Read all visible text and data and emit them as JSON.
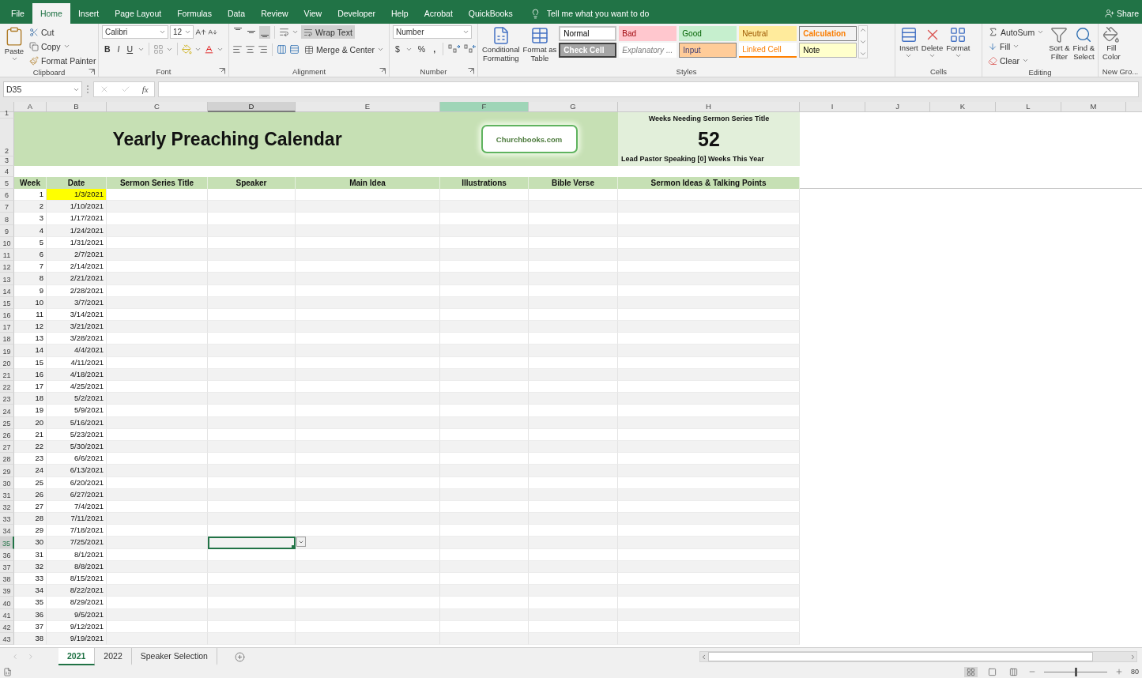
{
  "menu_tabs": [
    {
      "label": "File",
      "selected": false
    },
    {
      "label": "Home",
      "selected": true
    },
    {
      "label": "Insert",
      "selected": false
    },
    {
      "label": "Page Layout",
      "selected": false
    },
    {
      "label": "Formulas",
      "selected": false
    },
    {
      "label": "Data",
      "selected": false
    },
    {
      "label": "Review",
      "selected": false
    },
    {
      "label": "View",
      "selected": false
    },
    {
      "label": "Developer",
      "selected": false
    },
    {
      "label": "Help",
      "selected": false
    },
    {
      "label": "Acrobat",
      "selected": false
    },
    {
      "label": "QuickBooks",
      "selected": false
    }
  ],
  "tell_me": "Tell me what you want to do",
  "share": "Share",
  "ribbon": {
    "clipboard": {
      "paste": "Paste",
      "cut": "Cut",
      "copy": "Copy",
      "format_painter": "Format Painter",
      "label": "Clipboard"
    },
    "font": {
      "name": "Calibri",
      "size": "12",
      "bold": "B",
      "italic": "I",
      "underline": "U",
      "label": "Font"
    },
    "alignment": {
      "vertical_align": [
        {
          "selected": false
        },
        {
          "selected": false
        },
        {
          "selected": true
        }
      ],
      "wrap_text": {
        "label": "Wrap Text",
        "selected": true
      },
      "merge": "Merge & Center",
      "label": "Alignment"
    },
    "number": {
      "format": "Number",
      "currency": "$",
      "percent": "%",
      "comma": ",",
      "label": "Number"
    },
    "styles": {
      "conditional": [
        "Conditional",
        "Formatting"
      ],
      "format_table": [
        "Format as",
        "Table"
      ],
      "gallery": [
        {
          "kind": "normal",
          "label": "Normal"
        },
        {
          "kind": "bad",
          "label": "Bad"
        },
        {
          "kind": "good",
          "label": "Good"
        },
        {
          "kind": "neutral",
          "label": "Neutral"
        },
        {
          "kind": "calculation",
          "label": "Calculation"
        },
        {
          "kind": "check",
          "label": "Check Cell"
        },
        {
          "kind": "explanatory",
          "label": "Explanatory ..."
        },
        {
          "kind": "input",
          "label": "Input"
        },
        {
          "kind": "linked",
          "label": "Linked Cell"
        },
        {
          "kind": "note",
          "label": "Note"
        }
      ],
      "label": "Styles"
    },
    "cells": {
      "buttons": [
        "Insert",
        "Delete",
        "Format"
      ],
      "label": "Cells"
    },
    "editing": {
      "autosum": "AutoSum",
      "fill": "Fill",
      "clear": "Clear",
      "sort": [
        "Sort &",
        "Filter"
      ],
      "find": [
        "Find &",
        "Select"
      ],
      "label": "Editing"
    },
    "new_group": {
      "fill_color": [
        "Fill",
        "Color"
      ],
      "label": "New Gro..."
    }
  },
  "formula_bar": {
    "name_box": "D35",
    "fx": "fx"
  },
  "column_headers": [
    {
      "label": "A",
      "selected": false,
      "highlighted": false
    },
    {
      "label": "B",
      "selected": false,
      "highlighted": false
    },
    {
      "label": "C",
      "selected": false,
      "highlighted": false
    },
    {
      "label": "D",
      "selected": true,
      "highlighted": false
    },
    {
      "label": "E",
      "selected": false,
      "highlighted": false
    },
    {
      "label": "F",
      "selected": false,
      "highlighted": true
    },
    {
      "label": "G",
      "selected": false,
      "highlighted": false
    },
    {
      "label": "H",
      "selected": false,
      "highlighted": false
    },
    {
      "label": "I",
      "selected": false,
      "highlighted": false
    },
    {
      "label": "J",
      "selected": false,
      "highlighted": false
    },
    {
      "label": "K",
      "selected": false,
      "highlighted": false
    },
    {
      "label": "L",
      "selected": false,
      "highlighted": false
    },
    {
      "label": "M",
      "selected": false,
      "highlighted": false
    }
  ],
  "row_headers": [
    {
      "label": "1",
      "selected": false
    },
    {
      "label": "2",
      "selected": false
    },
    {
      "label": "3",
      "selected": false
    },
    {
      "label": "4",
      "selected": false
    },
    {
      "label": "5",
      "selected": false
    },
    {
      "label": "6",
      "selected": false
    },
    {
      "label": "7",
      "selected": false
    },
    {
      "label": "8",
      "selected": false
    },
    {
      "label": "9",
      "selected": false
    },
    {
      "label": "10",
      "selected": false
    },
    {
      "label": "11",
      "selected": false
    },
    {
      "label": "12",
      "selected": false
    },
    {
      "label": "13",
      "selected": false
    },
    {
      "label": "14",
      "selected": false
    },
    {
      "label": "15",
      "selected": false
    },
    {
      "label": "16",
      "selected": false
    },
    {
      "label": "17",
      "selected": false
    },
    {
      "label": "18",
      "selected": false
    },
    {
      "label": "19",
      "selected": false
    },
    {
      "label": "20",
      "selected": false
    },
    {
      "label": "21",
      "selected": false
    },
    {
      "label": "22",
      "selected": false
    },
    {
      "label": "23",
      "selected": false
    },
    {
      "label": "24",
      "selected": false
    },
    {
      "label": "25",
      "selected": false
    },
    {
      "label": "26",
      "selected": false
    },
    {
      "label": "27",
      "selected": false
    },
    {
      "label": "28",
      "selected": false
    },
    {
      "label": "29",
      "selected": false
    },
    {
      "label": "30",
      "selected": false
    },
    {
      "label": "31",
      "selected": false
    },
    {
      "label": "32",
      "selected": false
    },
    {
      "label": "33",
      "selected": false
    },
    {
      "label": "34",
      "selected": false
    },
    {
      "label": "35",
      "selected": true
    },
    {
      "label": "36",
      "selected": false
    },
    {
      "label": "37",
      "selected": false
    },
    {
      "label": "38",
      "selected": false
    },
    {
      "label": "39",
      "selected": false
    },
    {
      "label": "40",
      "selected": false
    },
    {
      "label": "41",
      "selected": false
    },
    {
      "label": "42",
      "selected": false
    },
    {
      "label": "43",
      "selected": false
    }
  ],
  "sheet": {
    "title": "Yearly Preaching Calendar",
    "link": "Churchbooks.com",
    "summary": {
      "heading": "Weeks Needing Sermon Series Title",
      "count": "52",
      "note": "Lead Pastor Speaking [0] Weeks This Year"
    },
    "columns": [
      "Week",
      "Date",
      "Sermon Series Title",
      "Speaker",
      "Main Idea",
      "Illustrations",
      "Bible Verse",
      "Sermon Ideas & Talking Points"
    ],
    "rows": [
      {
        "week": "1",
        "date": "1/3/2021",
        "date_highlighted": true,
        "speaker_selected": false
      },
      {
        "week": "2",
        "date": "1/10/2021",
        "date_highlighted": false,
        "speaker_selected": false
      },
      {
        "week": "3",
        "date": "1/17/2021",
        "date_highlighted": false,
        "speaker_selected": false
      },
      {
        "week": "4",
        "date": "1/24/2021",
        "date_highlighted": false,
        "speaker_selected": false
      },
      {
        "week": "5",
        "date": "1/31/2021",
        "date_highlighted": false,
        "speaker_selected": false
      },
      {
        "week": "6",
        "date": "2/7/2021",
        "date_highlighted": false,
        "speaker_selected": false
      },
      {
        "week": "7",
        "date": "2/14/2021",
        "date_highlighted": false,
        "speaker_selected": false
      },
      {
        "week": "8",
        "date": "2/21/2021",
        "date_highlighted": false,
        "speaker_selected": false
      },
      {
        "week": "9",
        "date": "2/28/2021",
        "date_highlighted": false,
        "speaker_selected": false
      },
      {
        "week": "10",
        "date": "3/7/2021",
        "date_highlighted": false,
        "speaker_selected": false
      },
      {
        "week": "11",
        "date": "3/14/2021",
        "date_highlighted": false,
        "speaker_selected": false
      },
      {
        "week": "12",
        "date": "3/21/2021",
        "date_highlighted": false,
        "speaker_selected": false
      },
      {
        "week": "13",
        "date": "3/28/2021",
        "date_highlighted": false,
        "speaker_selected": false
      },
      {
        "week": "14",
        "date": "4/4/2021",
        "date_highlighted": false,
        "speaker_selected": false
      },
      {
        "week": "15",
        "date": "4/11/2021",
        "date_highlighted": false,
        "speaker_selected": false
      },
      {
        "week": "16",
        "date": "4/18/2021",
        "date_highlighted": false,
        "speaker_selected": false
      },
      {
        "week": "17",
        "date": "4/25/2021",
        "date_highlighted": false,
        "speaker_selected": false
      },
      {
        "week": "18",
        "date": "5/2/2021",
        "date_highlighted": false,
        "speaker_selected": false
      },
      {
        "week": "19",
        "date": "5/9/2021",
        "date_highlighted": false,
        "speaker_selected": false
      },
      {
        "week": "20",
        "date": "5/16/2021",
        "date_highlighted": false,
        "speaker_selected": false
      },
      {
        "week": "21",
        "date": "5/23/2021",
        "date_highlighted": false,
        "speaker_selected": false
      },
      {
        "week": "22",
        "date": "5/30/2021",
        "date_highlighted": false,
        "speaker_selected": false
      },
      {
        "week": "23",
        "date": "6/6/2021",
        "date_highlighted": false,
        "speaker_selected": false
      },
      {
        "week": "24",
        "date": "6/13/2021",
        "date_highlighted": false,
        "speaker_selected": false
      },
      {
        "week": "25",
        "date": "6/20/2021",
        "date_highlighted": false,
        "speaker_selected": false
      },
      {
        "week": "26",
        "date": "6/27/2021",
        "date_highlighted": false,
        "speaker_selected": false
      },
      {
        "week": "27",
        "date": "7/4/2021",
        "date_highlighted": false,
        "speaker_selected": false
      },
      {
        "week": "28",
        "date": "7/11/2021",
        "date_highlighted": false,
        "speaker_selected": false
      },
      {
        "week": "29",
        "date": "7/18/2021",
        "date_highlighted": false,
        "speaker_selected": false
      },
      {
        "week": "30",
        "date": "7/25/2021",
        "date_highlighted": false,
        "speaker_selected": true
      },
      {
        "week": "31",
        "date": "8/1/2021",
        "date_highlighted": false,
        "speaker_selected": false
      },
      {
        "week": "32",
        "date": "8/8/2021",
        "date_highlighted": false,
        "speaker_selected": false
      },
      {
        "week": "33",
        "date": "8/15/2021",
        "date_highlighted": false,
        "speaker_selected": false
      },
      {
        "week": "34",
        "date": "8/22/2021",
        "date_highlighted": false,
        "speaker_selected": false
      },
      {
        "week": "35",
        "date": "8/29/2021",
        "date_highlighted": false,
        "speaker_selected": false
      },
      {
        "week": "36",
        "date": "9/5/2021",
        "date_highlighted": false,
        "speaker_selected": false
      },
      {
        "week": "37",
        "date": "9/12/2021",
        "date_highlighted": false,
        "speaker_selected": false
      },
      {
        "week": "38",
        "date": "9/19/2021",
        "date_highlighted": false,
        "speaker_selected": false
      }
    ]
  },
  "sheet_tabs": [
    {
      "label": "2021",
      "selected": true
    },
    {
      "label": "2022",
      "selected": false
    },
    {
      "label": "Speaker Selection",
      "selected": false
    }
  ],
  "status_bar": {
    "zoom": {
      "level": 0.5,
      "reading": "80"
    }
  }
}
